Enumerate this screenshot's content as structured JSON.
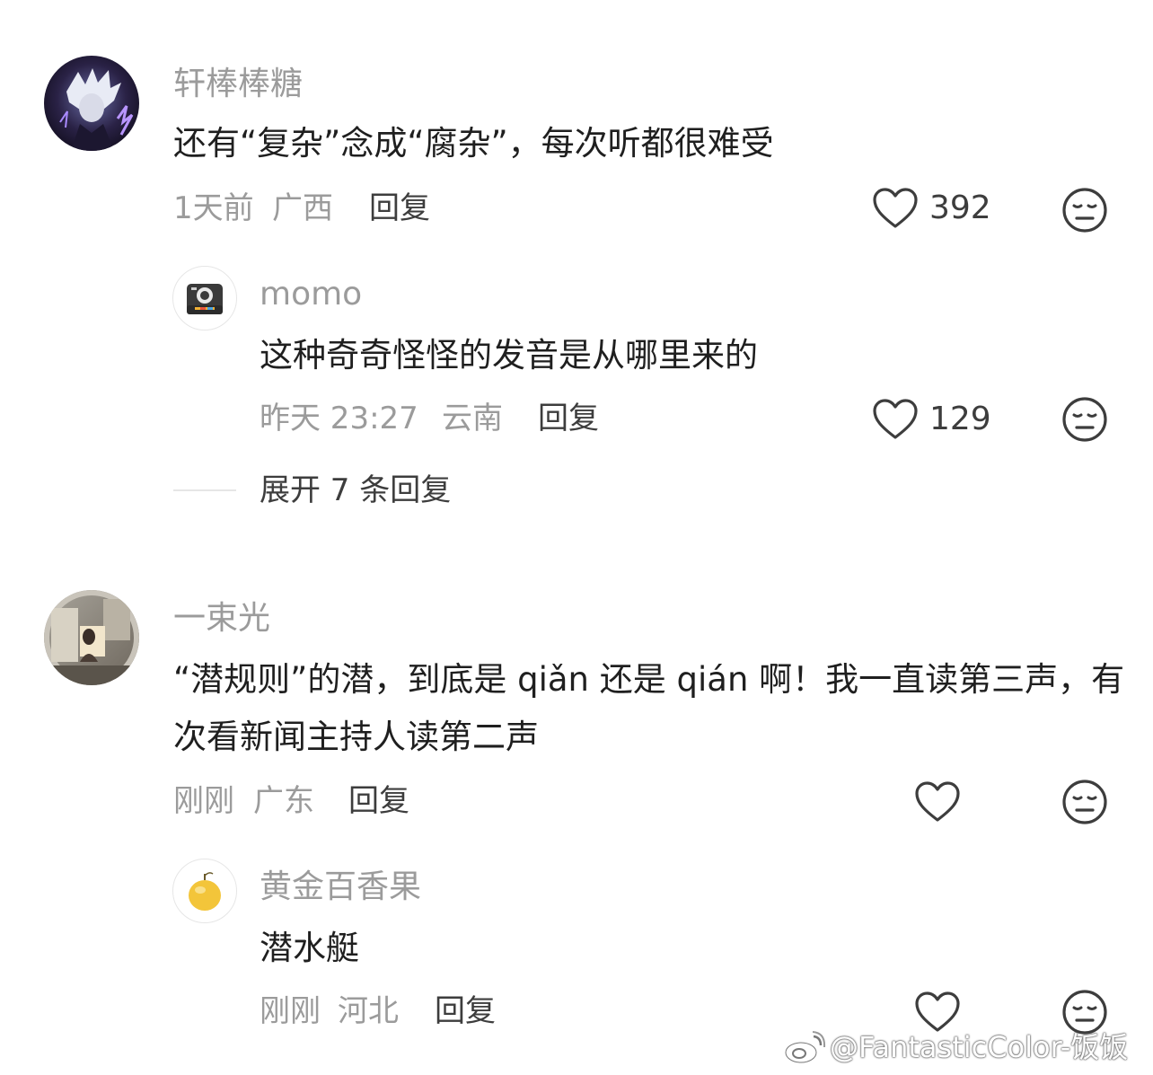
{
  "comments": [
    {
      "username": "轩棒棒糖",
      "text": "还有“复杂”念成“腐杂”，每次听都很难受",
      "time": "1天前",
      "location": "广西",
      "reply_label": "回复",
      "likes": "392",
      "replies": [
        {
          "username": "momo",
          "text": "这种奇奇怪怪的发音是从哪里来的",
          "time": "昨天 23:27",
          "location": "云南",
          "reply_label": "回复",
          "likes": "129"
        }
      ],
      "expand_label": "展开 7 条回复"
    },
    {
      "username": "一束光",
      "text": "“潜规则”的潜，到底是 qiǎn 还是 qián 啊！我一直读第三声，有次看新闻主持人读第二声",
      "time": "刚刚",
      "location": "广东",
      "reply_label": "回复",
      "likes": "",
      "replies": [
        {
          "username": "黄金百香果",
          "text": "潜水艇",
          "time": "刚刚",
          "location": "河北",
          "reply_label": "回复",
          "likes": ""
        }
      ]
    }
  ],
  "icons": {
    "like": "heart-outline-icon",
    "dislike": "meh-face-icon",
    "weibo": "weibo-logo-icon"
  },
  "watermark": "@FantasticColor-饭饭",
  "colors": {
    "primary_text": "#1f1f1f",
    "secondary_text": "#9b9b9b",
    "action_text": "#3d3d3d"
  }
}
